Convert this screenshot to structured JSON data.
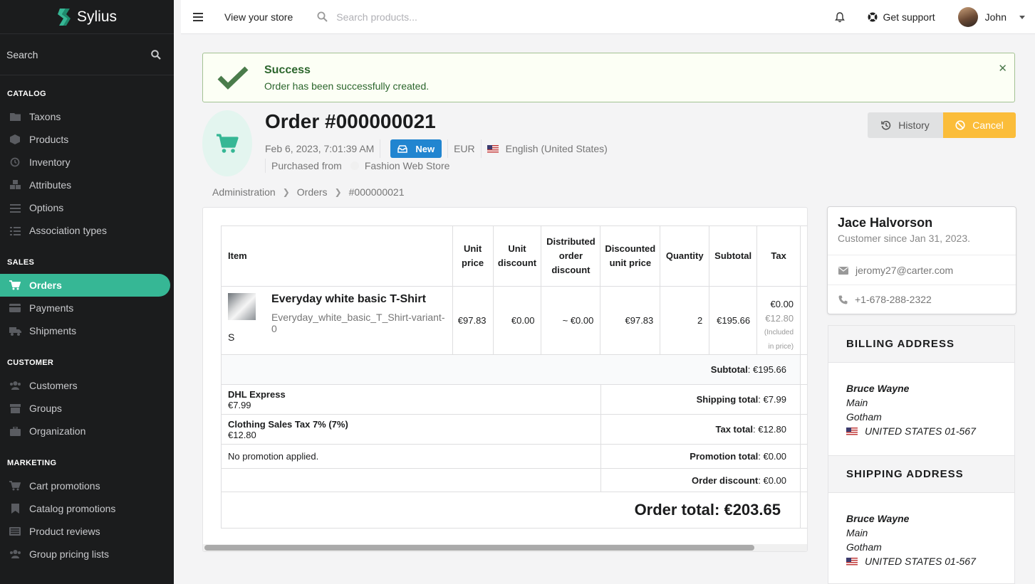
{
  "sidebar": {
    "brand": "Sylius",
    "search_label": "Search",
    "sections": {
      "catalog": "CATALOG",
      "sales": "SALES",
      "customer": "CUSTOMER",
      "marketing": "MARKETING"
    },
    "catalog_items": [
      "Taxons",
      "Products",
      "Inventory",
      "Attributes",
      "Options",
      "Association types"
    ],
    "sales_items": [
      "Orders",
      "Payments",
      "Shipments"
    ],
    "customer_items": [
      "Customers",
      "Groups",
      "Organization"
    ],
    "marketing_items": [
      "Cart promotions",
      "Catalog promotions",
      "Product reviews",
      "Group pricing lists"
    ],
    "active_item": "Orders",
    "accent_color": "#36b795"
  },
  "topbar": {
    "view_store": "View your store",
    "search_placeholder": "Search products...",
    "support": "Get support",
    "user_name": "John"
  },
  "alert": {
    "title": "Success",
    "message": "Order has been successfully created."
  },
  "order": {
    "title": "Order #000000021",
    "date": "Feb 6, 2023, 7:01:39 AM",
    "status": "New",
    "currency": "EUR",
    "locale": "English (United States)",
    "purchased_from_label": "Purchased from",
    "channel": "Fashion Web Store",
    "history_button": "History",
    "cancel_button": "Cancel"
  },
  "breadcrumb": [
    "Administration",
    "Orders",
    "#000000021"
  ],
  "items_table": {
    "headers": {
      "item": "Item",
      "unit_price": "Unit price",
      "unit_discount": "Unit discount",
      "distributed_order_discount": "Distributed order discount",
      "discounted_unit_price": "Discounted unit price",
      "quantity": "Quantity",
      "subtotal": "Subtotal",
      "tax": "Tax"
    },
    "rows": [
      {
        "name": "Everyday white basic T-Shirt",
        "variant": "Everyday_white_basic_T_Shirt-variant-0",
        "size": "S",
        "unit_price": "€97.83",
        "unit_discount": "€0.00",
        "distributed_order_discount": "~ €0.00",
        "discounted_unit_price": "€97.83",
        "quantity": "2",
        "subtotal": "€195.66",
        "tax_1": "€0.00",
        "tax_2": "€12.80",
        "tax_3": "(Included",
        "tax_4": "in price)"
      }
    ],
    "subtotal_label": "Subtotal",
    "subtotal_value": ": €195.66",
    "shipping_name": "DHL Express",
    "shipping_amount": "€7.99",
    "shipping_total_label": "Shipping total",
    "shipping_total_value": ": €7.99",
    "tax_name": "Clothing Sales Tax 7% (7%)",
    "tax_amount": "€12.80",
    "tax_total_label": "Tax total",
    "tax_total_value": ": €12.80",
    "promotion_text": "No promotion applied.",
    "promotion_total_label": "Promotion total",
    "promotion_total_value": ": €0.00",
    "order_discount_label": "Order discount",
    "order_discount_value": ": €0.00",
    "order_total": "Order total: €203.65"
  },
  "customer": {
    "name": "Jace Halvorson",
    "since": "Customer since Jan 31, 2023.",
    "email": "jeromy27@carter.com",
    "phone": "+1-678-288-2322"
  },
  "billing": {
    "title": "BILLING ADDRESS",
    "name": "Bruce Wayne",
    "street": "Main",
    "city": "Gotham",
    "country": "UNITED STATES 01-567"
  },
  "shipping": {
    "title": "SHIPPING ADDRESS",
    "name": "Bruce Wayne",
    "street": "Main",
    "city": "Gotham",
    "country": "UNITED STATES 01-567"
  }
}
